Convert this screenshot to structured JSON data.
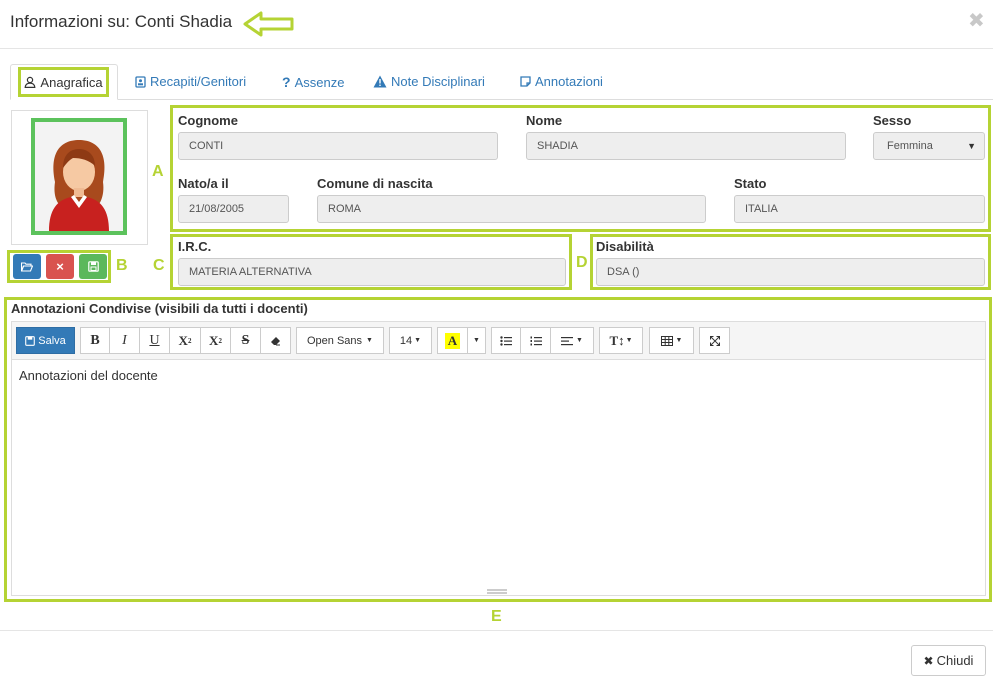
{
  "header": {
    "title": "Informazioni su: Conti Shadia",
    "close_symbol": "✖"
  },
  "tabs": [
    {
      "label": "Anagrafica",
      "icon": "user-icon"
    },
    {
      "label": "Recapiti/Genitori",
      "icon": "address-card-icon"
    },
    {
      "label": "Assenze",
      "icon": "question-icon"
    },
    {
      "label": "Note Disciplinari",
      "icon": "warning-icon"
    },
    {
      "label": "Annotazioni",
      "icon": "note-icon"
    }
  ],
  "photo_buttons": {
    "open": "folder-open-icon",
    "delete": "×",
    "save": "save-icon"
  },
  "markers": {
    "a": "A",
    "b": "B",
    "c": "C",
    "d": "D",
    "e": "E"
  },
  "anagrafica": {
    "cognome_label": "Cognome",
    "cognome_value": "CONTI",
    "nome_label": "Nome",
    "nome_value": "SHADIA",
    "sesso_label": "Sesso",
    "sesso_value": "Femmina",
    "nato_label": "Nato/a il",
    "nato_value": "21/08/2005",
    "comune_label": "Comune di nascita",
    "comune_value": "ROMA",
    "stato_label": "Stato",
    "stato_value": "ITALIA"
  },
  "irc": {
    "label": "I.R.C.",
    "value": "MATERIA ALTERNATIVA"
  },
  "disabilita": {
    "label": "Disabilità",
    "value": "DSA ()"
  },
  "annotazioni": {
    "label": "Annotazioni Condivise (visibili da tutti i docenti)",
    "save_label": "Salva",
    "font_name": "Open Sans",
    "font_size": "14",
    "content": "Annotazioni del docente"
  },
  "footer": {
    "close_label": "Chiudi"
  },
  "colors": {
    "accent": "#b5d334",
    "primary": "#337ab7",
    "danger": "#d9534f",
    "success": "#5cb85c"
  }
}
